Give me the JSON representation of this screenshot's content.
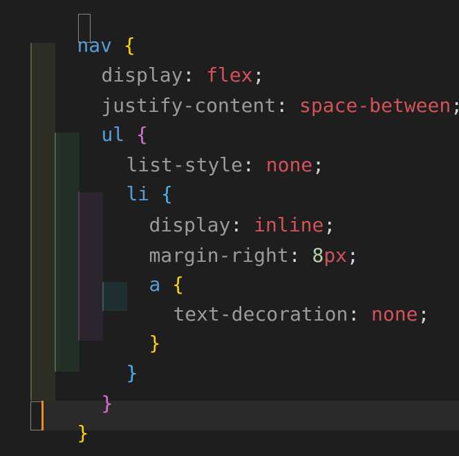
{
  "code": {
    "l1": {
      "selector": "nav",
      "open": "{"
    },
    "l2": {
      "prop": "display",
      "colon": ":",
      "value": "flex",
      "semi": ";"
    },
    "l3": {
      "prop": "justify-content",
      "colon": ":",
      "value": "space-between",
      "semi": ";"
    },
    "l4": {
      "selector": "ul",
      "open": "{"
    },
    "l5": {
      "prop": "list-style",
      "colon": ":",
      "value": "none",
      "semi": ";"
    },
    "l6": {
      "selector": "li",
      "open": "{"
    },
    "l7": {
      "prop": "display",
      "colon": ":",
      "value": "inline",
      "semi": ";"
    },
    "l8": {
      "prop": "margin-right",
      "colon": ":",
      "number": "8",
      "unit": "px",
      "semi": ";"
    },
    "l9": {
      "selector": "a",
      "open": "{"
    },
    "l10": {
      "prop": "text-decoration",
      "colon": ":",
      "value": "none",
      "semi": ";"
    },
    "l11": {
      "close": "}"
    },
    "l12": {
      "close": "}"
    },
    "l13": {
      "close": "}"
    },
    "l14": {
      "close": "}"
    }
  },
  "colors": {
    "background": "#1e1e1e",
    "selector": "#569cd6",
    "property": "#9b9b9b",
    "value": "#d4525a",
    "bracket_level1": "#ffd700",
    "bracket_level2": "#da70d6",
    "bracket_level3": "#4fb0f0",
    "cursor": "#f08a24"
  }
}
